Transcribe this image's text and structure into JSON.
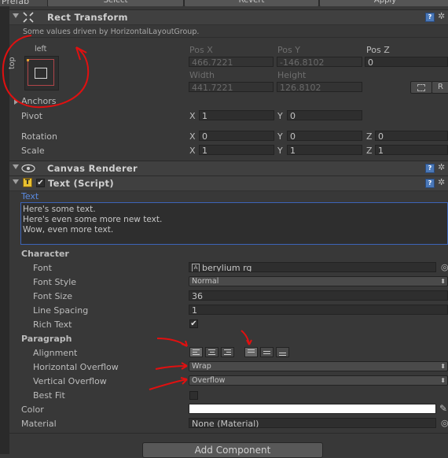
{
  "toolbar": {
    "prefab": "Prefab",
    "select": "Select",
    "revert": "Revert",
    "apply": "Apply"
  },
  "rect_transform": {
    "title": "Rect Transform",
    "driven_note": "Some values driven by HorizontalLayoutGroup.",
    "anchor_preset": {
      "horizontal": "left",
      "vertical": "top"
    },
    "pos_x_label": "Pos X",
    "pos_y_label": "Pos Y",
    "pos_z_label": "Pos Z",
    "pos_x": "466.7221",
    "pos_y": "-146.8102",
    "pos_z": "0",
    "width_label": "Width",
    "height_label": "Height",
    "width": "441.7221",
    "height": "126.8102",
    "r_button": "R",
    "anchors_label": "Anchors",
    "pivot_label": "Pivot",
    "pivot_x": "1",
    "pivot_y": "0",
    "rotation_label": "Rotation",
    "rot_x": "0",
    "rot_y": "0",
    "rot_z": "0",
    "scale_label": "Scale",
    "scale_x": "1",
    "scale_y": "1",
    "scale_z": "1",
    "axis_x": "X",
    "axis_y": "Y",
    "axis_z": "Z"
  },
  "canvas_renderer": {
    "title": "Canvas Renderer"
  },
  "text_script": {
    "title": "Text (Script)",
    "text_label": "Text",
    "text_lines": [
      "Here's some text.",
      "Here's even some more new text.",
      "Wow, even more text."
    ],
    "character_label": "Character",
    "font_label": "Font",
    "font_value": "berylium rg",
    "font_style_label": "Font Style",
    "font_style_value": "Normal",
    "font_size_label": "Font Size",
    "font_size_value": "36",
    "line_spacing_label": "Line Spacing",
    "line_spacing_value": "1",
    "rich_text_label": "Rich Text",
    "rich_text_checked": "✔",
    "paragraph_label": "Paragraph",
    "alignment_label": "Alignment",
    "h_overflow_label": "Horizontal Overflow",
    "h_overflow_value": "Wrap",
    "v_overflow_label": "Vertical Overflow",
    "v_overflow_value": "Overflow",
    "best_fit_label": "Best Fit",
    "color_label": "Color",
    "material_label": "Material",
    "material_value": "None (Material)"
  },
  "add_component": "Add Component",
  "colors": {
    "annotation": "#e01010",
    "text_label_blue": "#5a8ae0",
    "panel": "#383838"
  }
}
